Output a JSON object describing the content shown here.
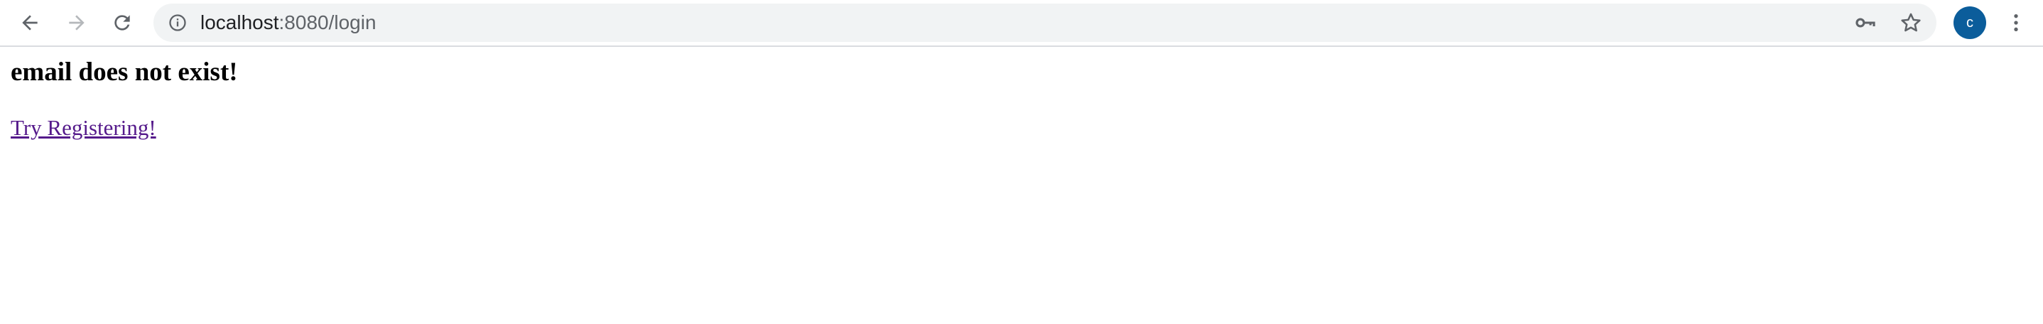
{
  "browser": {
    "url_host": "localhost",
    "url_rest": ":8080/login",
    "profile_initial": "c",
    "profile_color": "#0b5d9b"
  },
  "page": {
    "heading": "email does not exist!",
    "link_text": "Try Registering!",
    "link_color": "#551a8b"
  }
}
